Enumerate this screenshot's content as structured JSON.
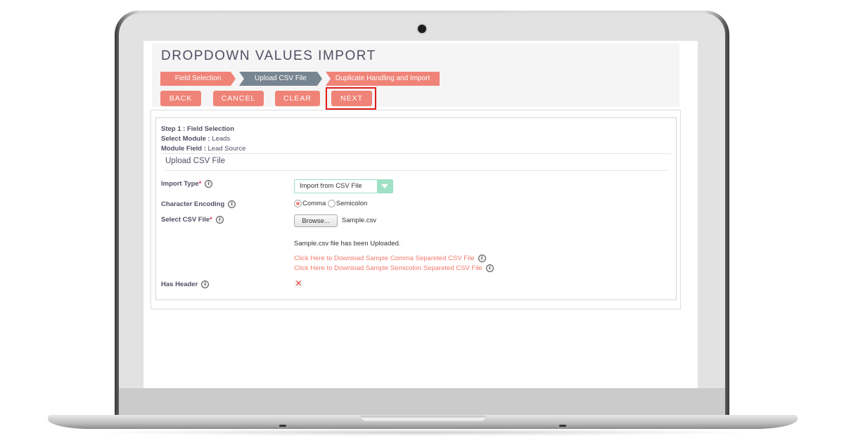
{
  "page": {
    "title": "DROPDOWN VALUES IMPORT",
    "steps": [
      {
        "label": "Field Selection",
        "state": "done"
      },
      {
        "label": "Upload CSV File",
        "state": "current"
      },
      {
        "label": "Duplicate Handling and Import",
        "state": "pending"
      }
    ],
    "buttons": {
      "back": "BACK",
      "cancel": "CANCEL",
      "clear": "CLEAR",
      "next": "NEXT"
    },
    "highlighted_button": "next"
  },
  "summary": {
    "step_label": "Step 1 : Field Selection",
    "module_label": "Select Module :",
    "module_value": "Leads",
    "field_label": "Module Field :",
    "field_value": "Lead Source"
  },
  "section_title": "Upload CSV File",
  "form": {
    "import_type": {
      "label": "Import Type",
      "required": "*",
      "value": "Import from CSV File"
    },
    "character_encoding": {
      "label": "Character Encoding",
      "options": [
        "Comma",
        "Semicolon"
      ],
      "selected": "Comma"
    },
    "csv_file": {
      "label": "Select CSV File",
      "required": "*",
      "browse_label": "Browse...",
      "filename": "Sample.csv"
    },
    "upload_status": "Sample.csv file has been Uploaded.",
    "links": [
      "Click Here to Download Sample Comma Separeted CSV File",
      "Click Here to Download Sample Semicolon Separeted CSV File"
    ],
    "has_header": {
      "label": "Has Header",
      "checked": false,
      "mark": "✕"
    }
  },
  "icons": {
    "info": "i"
  },
  "colors": {
    "accent": "#f08377",
    "step_current": "#778591",
    "select_accent": "#9fe0c7",
    "highlight": "#e01b1b",
    "link": "#f07a6c"
  }
}
